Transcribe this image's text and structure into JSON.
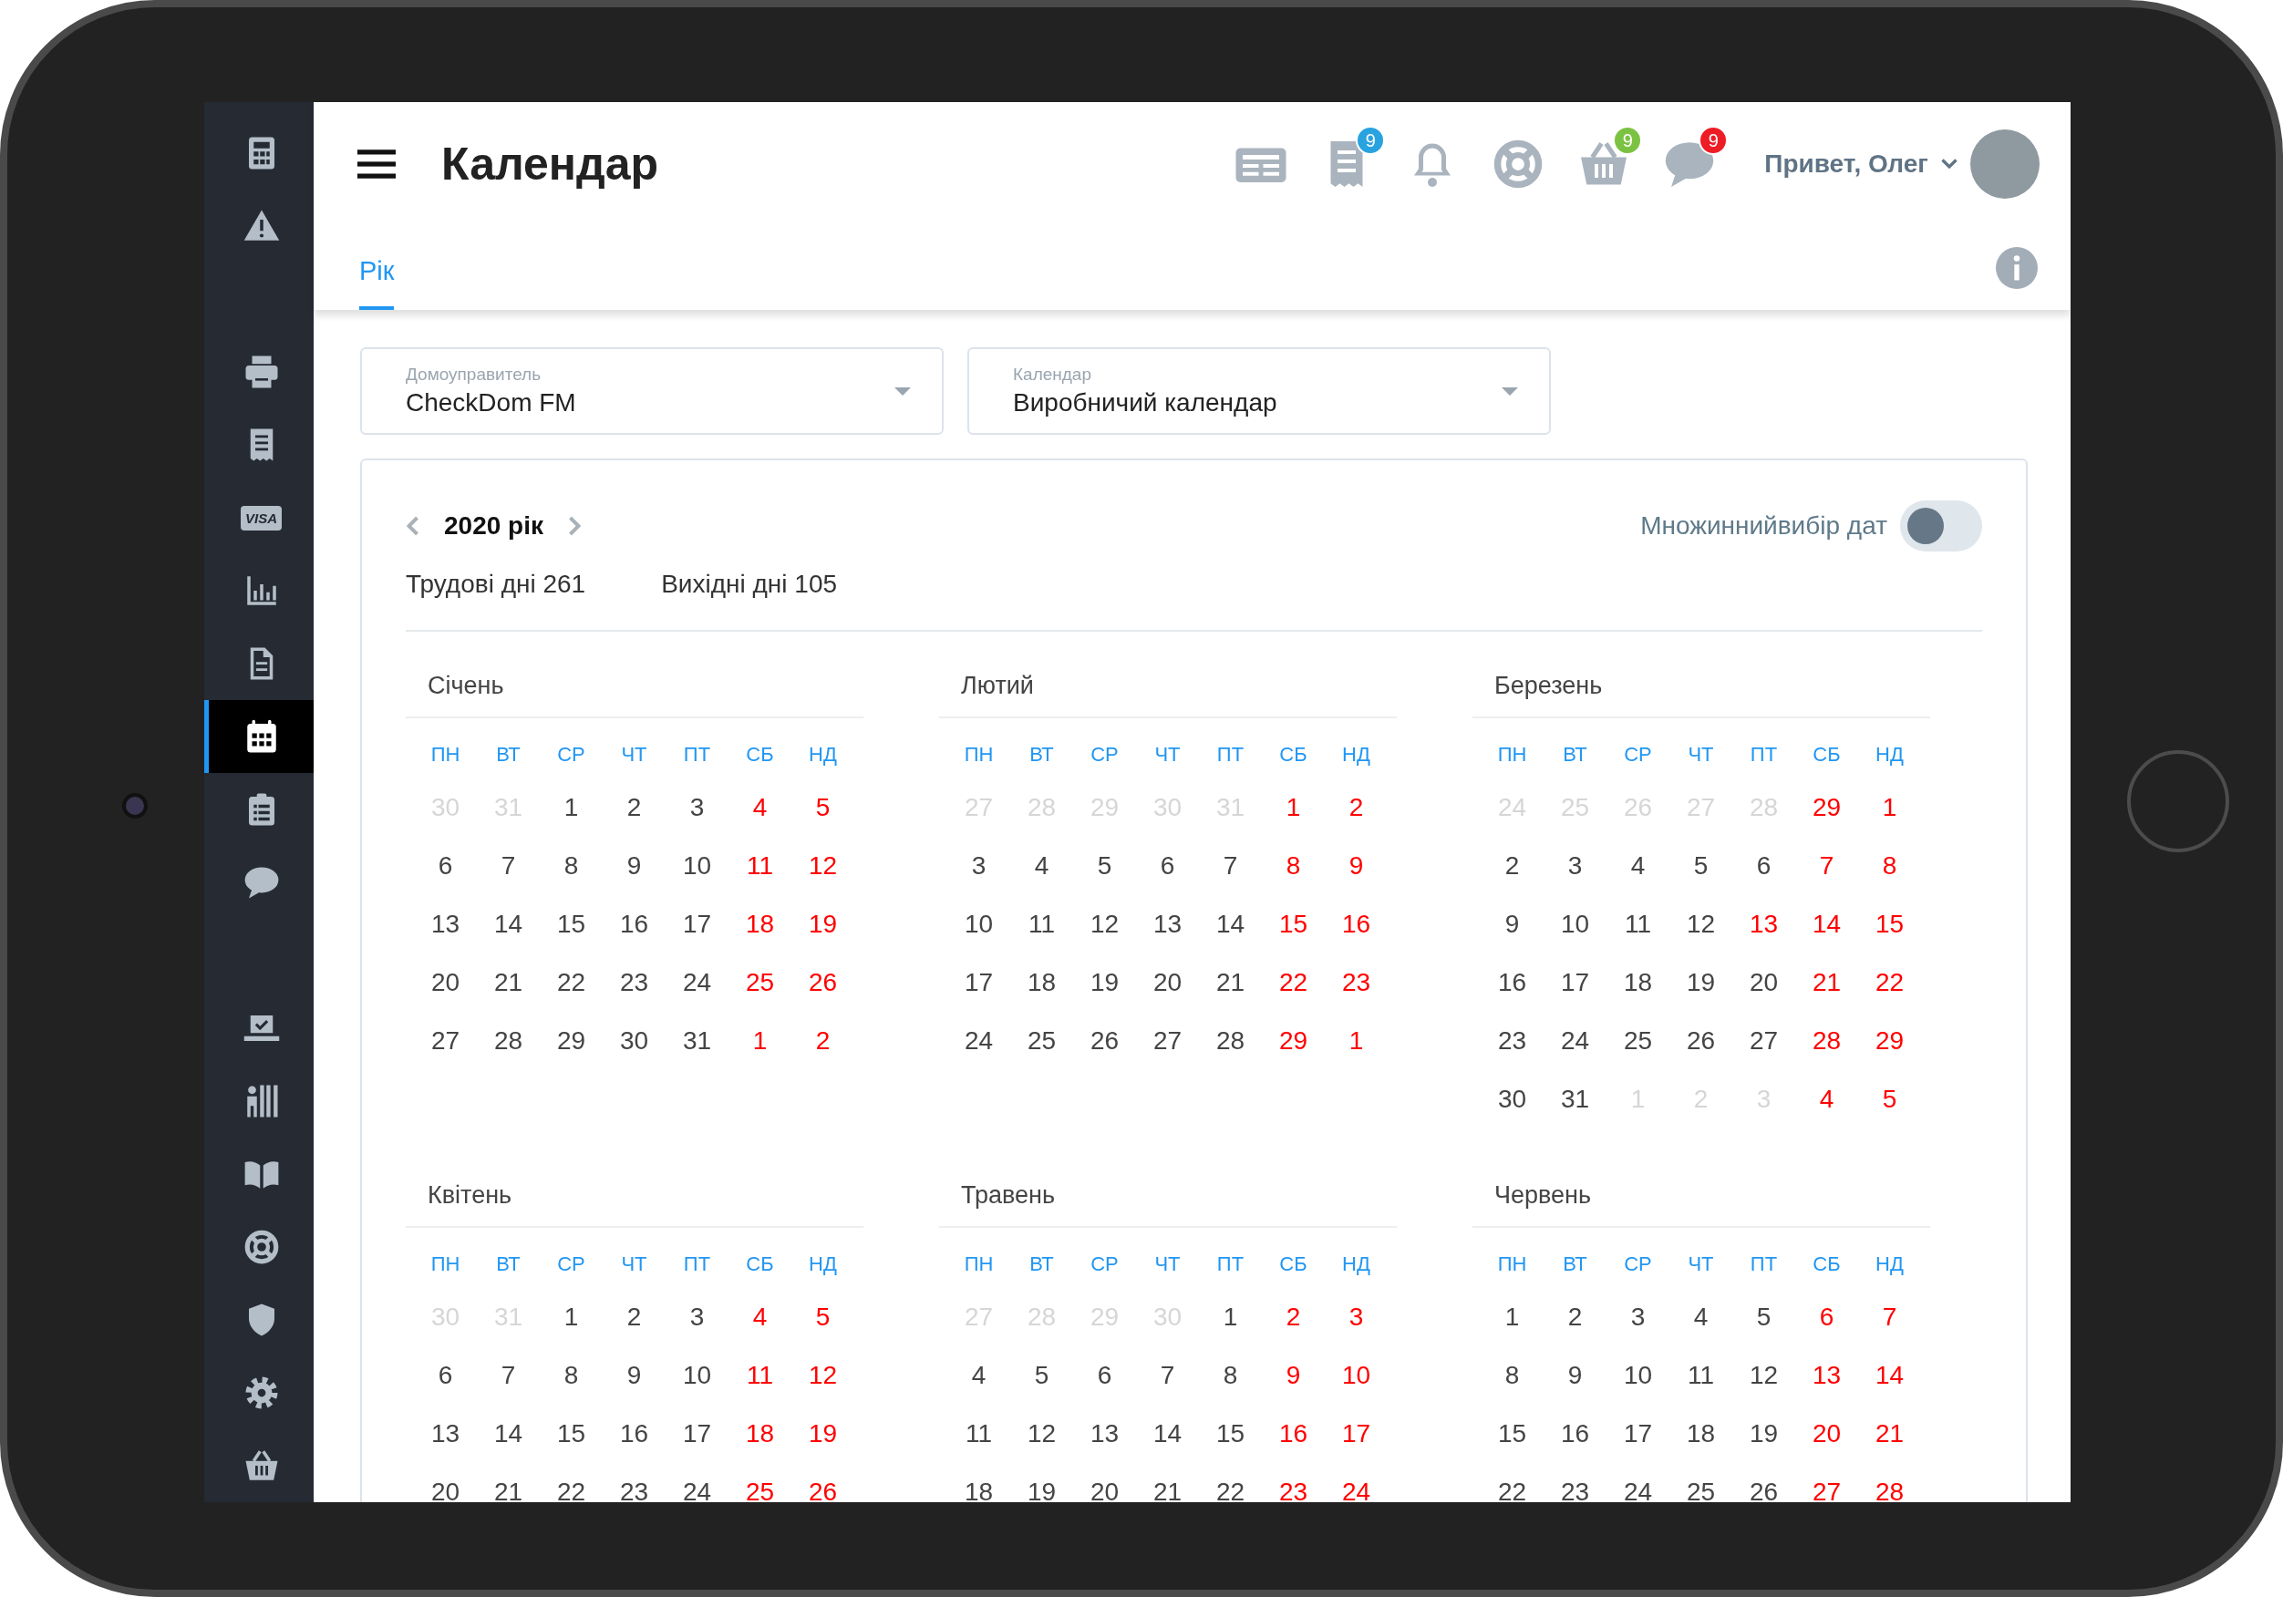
{
  "sidebar": {
    "groups": [
      [
        {
          "kind": "calculator",
          "selected": false
        },
        {
          "kind": "warning",
          "selected": false
        }
      ],
      [
        {
          "kind": "printer",
          "selected": false
        },
        {
          "kind": "receipt",
          "selected": false
        },
        {
          "kind": "card",
          "label": "VISA",
          "selected": false
        },
        {
          "kind": "bar-chart",
          "selected": false
        },
        {
          "kind": "document",
          "selected": false
        },
        {
          "kind": "calendar",
          "selected": true
        },
        {
          "kind": "clipboard",
          "selected": false
        },
        {
          "kind": "chat",
          "selected": false
        }
      ],
      [
        {
          "kind": "laptop-check",
          "selected": false
        },
        {
          "kind": "person-shelves",
          "selected": false
        },
        {
          "kind": "book",
          "selected": false
        },
        {
          "kind": "lifebuoy",
          "selected": false
        },
        {
          "kind": "shield",
          "selected": false
        },
        {
          "kind": "settings",
          "selected": false
        },
        {
          "kind": "basket",
          "selected": false
        }
      ]
    ]
  },
  "header": {
    "title": "Календар",
    "icons": [
      {
        "kind": "newspaper"
      },
      {
        "kind": "receipt",
        "badge": {
          "text": "9",
          "color": "#29a3e0"
        }
      },
      {
        "kind": "bell"
      },
      {
        "kind": "lifebuoy"
      },
      {
        "kind": "basket",
        "badge": {
          "text": "9",
          "color": "#7cc242"
        }
      },
      {
        "kind": "chat",
        "badge": {
          "text": "9",
          "color": "#ee1c25"
        }
      }
    ],
    "greeting": "Привет, Олег"
  },
  "tabs": [
    {
      "label": "Рік",
      "selected": true
    }
  ],
  "dropdowns": [
    {
      "label": "Домоуправитель",
      "value": "CheckDom FM"
    },
    {
      "label": "Календар",
      "value": "Виробничий календар"
    }
  ],
  "calendar": {
    "year": "2020 рік",
    "stats": [
      "Трудові дні 261",
      "Вихідні дні 105"
    ],
    "multi_select": {
      "label": "Множиннийвибір дат",
      "on": false
    },
    "months": [
      {
        "name": "Січень",
        "weekdays": [
          "ПН",
          "ВТ",
          "СР",
          "ЧТ",
          "ПТ",
          "СБ",
          "НД"
        ],
        "weeks": [
          [
            {
              "d": "30",
              "kind": "out"
            },
            {
              "d": "31",
              "kind": "out"
            },
            {
              "d": "1",
              "kind": "work"
            },
            {
              "d": "2",
              "kind": "work"
            },
            {
              "d": "3",
              "kind": "work"
            },
            {
              "d": "4",
              "kind": "off"
            },
            {
              "d": "5",
              "kind": "off"
            }
          ],
          [
            {
              "d": "6",
              "kind": "work"
            },
            {
              "d": "7",
              "kind": "work"
            },
            {
              "d": "8",
              "kind": "work"
            },
            {
              "d": "9",
              "kind": "work"
            },
            {
              "d": "10",
              "kind": "work"
            },
            {
              "d": "11",
              "kind": "off"
            },
            {
              "d": "12",
              "kind": "off"
            }
          ],
          [
            {
              "d": "13",
              "kind": "work"
            },
            {
              "d": "14",
              "kind": "work"
            },
            {
              "d": "15",
              "kind": "work"
            },
            {
              "d": "16",
              "kind": "work"
            },
            {
              "d": "17",
              "kind": "work"
            },
            {
              "d": "18",
              "kind": "off"
            },
            {
              "d": "19",
              "kind": "off"
            }
          ],
          [
            {
              "d": "20",
              "kind": "work"
            },
            {
              "d": "21",
              "kind": "work"
            },
            {
              "d": "22",
              "kind": "work"
            },
            {
              "d": "23",
              "kind": "work"
            },
            {
              "d": "24",
              "kind": "work"
            },
            {
              "d": "25",
              "kind": "off"
            },
            {
              "d": "26",
              "kind": "off"
            }
          ],
          [
            {
              "d": "27",
              "kind": "work"
            },
            {
              "d": "28",
              "kind": "work"
            },
            {
              "d": "29",
              "kind": "work"
            },
            {
              "d": "30",
              "kind": "work"
            },
            {
              "d": "31",
              "kind": "work"
            },
            {
              "d": "1",
              "kind": "off"
            },
            {
              "d": "2",
              "kind": "off"
            }
          ]
        ]
      },
      {
        "name": "Лютий",
        "weekdays": [
          "ПН",
          "ВТ",
          "СР",
          "ЧТ",
          "ПТ",
          "СБ",
          "НД"
        ],
        "weeks": [
          [
            {
              "d": "27",
              "kind": "out"
            },
            {
              "d": "28",
              "kind": "out"
            },
            {
              "d": "29",
              "kind": "out"
            },
            {
              "d": "30",
              "kind": "out"
            },
            {
              "d": "31",
              "kind": "out"
            },
            {
              "d": "1",
              "kind": "off"
            },
            {
              "d": "2",
              "kind": "off"
            }
          ],
          [
            {
              "d": "3",
              "kind": "work"
            },
            {
              "d": "4",
              "kind": "work"
            },
            {
              "d": "5",
              "kind": "work"
            },
            {
              "d": "6",
              "kind": "work"
            },
            {
              "d": "7",
              "kind": "work"
            },
            {
              "d": "8",
              "kind": "off"
            },
            {
              "d": "9",
              "kind": "off"
            }
          ],
          [
            {
              "d": "10",
              "kind": "work"
            },
            {
              "d": "11",
              "kind": "work"
            },
            {
              "d": "12",
              "kind": "work"
            },
            {
              "d": "13",
              "kind": "work"
            },
            {
              "d": "14",
              "kind": "work"
            },
            {
              "d": "15",
              "kind": "off"
            },
            {
              "d": "16",
              "kind": "off"
            }
          ],
          [
            {
              "d": "17",
              "kind": "work"
            },
            {
              "d": "18",
              "kind": "work"
            },
            {
              "d": "19",
              "kind": "work"
            },
            {
              "d": "20",
              "kind": "work"
            },
            {
              "d": "21",
              "kind": "work"
            },
            {
              "d": "22",
              "kind": "off"
            },
            {
              "d": "23",
              "kind": "off"
            }
          ],
          [
            {
              "d": "24",
              "kind": "work"
            },
            {
              "d": "25",
              "kind": "work"
            },
            {
              "d": "26",
              "kind": "work"
            },
            {
              "d": "27",
              "kind": "work"
            },
            {
              "d": "28",
              "kind": "work"
            },
            {
              "d": "29",
              "kind": "off"
            },
            {
              "d": "1",
              "kind": "off"
            }
          ]
        ]
      },
      {
        "name": "Березень",
        "weekdays": [
          "ПН",
          "ВТ",
          "СР",
          "ЧТ",
          "ПТ",
          "СБ",
          "НД"
        ],
        "weeks": [
          [
            {
              "d": "24",
              "kind": "out"
            },
            {
              "d": "25",
              "kind": "out"
            },
            {
              "d": "26",
              "kind": "out"
            },
            {
              "d": "27",
              "kind": "out"
            },
            {
              "d": "28",
              "kind": "out"
            },
            {
              "d": "29",
              "kind": "off"
            },
            {
              "d": "1",
              "kind": "off"
            }
          ],
          [
            {
              "d": "2",
              "kind": "work"
            },
            {
              "d": "3",
              "kind": "work"
            },
            {
              "d": "4",
              "kind": "work"
            },
            {
              "d": "5",
              "kind": "work"
            },
            {
              "d": "6",
              "kind": "work"
            },
            {
              "d": "7",
              "kind": "off"
            },
            {
              "d": "8",
              "kind": "off"
            }
          ],
          [
            {
              "d": "9",
              "kind": "work"
            },
            {
              "d": "10",
              "kind": "work"
            },
            {
              "d": "11",
              "kind": "work"
            },
            {
              "d": "12",
              "kind": "work"
            },
            {
              "d": "13",
              "kind": "off"
            },
            {
              "d": "14",
              "kind": "off"
            },
            {
              "d": "15",
              "kind": "off"
            }
          ],
          [
            {
              "d": "16",
              "kind": "work"
            },
            {
              "d": "17",
              "kind": "work"
            },
            {
              "d": "18",
              "kind": "work"
            },
            {
              "d": "19",
              "kind": "work"
            },
            {
              "d": "20",
              "kind": "work"
            },
            {
              "d": "21",
              "kind": "off"
            },
            {
              "d": "22",
              "kind": "off"
            }
          ],
          [
            {
              "d": "23",
              "kind": "work"
            },
            {
              "d": "24",
              "kind": "work"
            },
            {
              "d": "25",
              "kind": "work"
            },
            {
              "d": "26",
              "kind": "work"
            },
            {
              "d": "27",
              "kind": "work"
            },
            {
              "d": "28",
              "kind": "off"
            },
            {
              "d": "29",
              "kind": "off"
            }
          ],
          [
            {
              "d": "30",
              "kind": "work"
            },
            {
              "d": "31",
              "kind": "work"
            },
            {
              "d": "1",
              "kind": "out"
            },
            {
              "d": "2",
              "kind": "out"
            },
            {
              "d": "3",
              "kind": "out"
            },
            {
              "d": "4",
              "kind": "off"
            },
            {
              "d": "5",
              "kind": "off"
            }
          ]
        ]
      },
      {
        "name": "Квітень",
        "weekdays": [
          "ПН",
          "ВТ",
          "СР",
          "ЧТ",
          "ПТ",
          "СБ",
          "НД"
        ],
        "weeks": [
          [
            {
              "d": "30",
              "kind": "out"
            },
            {
              "d": "31",
              "kind": "out"
            },
            {
              "d": "1",
              "kind": "work"
            },
            {
              "d": "2",
              "kind": "work"
            },
            {
              "d": "3",
              "kind": "work"
            },
            {
              "d": "4",
              "kind": "off"
            },
            {
              "d": "5",
              "kind": "off"
            }
          ],
          [
            {
              "d": "6",
              "kind": "work"
            },
            {
              "d": "7",
              "kind": "work"
            },
            {
              "d": "8",
              "kind": "work"
            },
            {
              "d": "9",
              "kind": "work"
            },
            {
              "d": "10",
              "kind": "work"
            },
            {
              "d": "11",
              "kind": "off"
            },
            {
              "d": "12",
              "kind": "off"
            }
          ],
          [
            {
              "d": "13",
              "kind": "work"
            },
            {
              "d": "14",
              "kind": "work"
            },
            {
              "d": "15",
              "kind": "work"
            },
            {
              "d": "16",
              "kind": "work"
            },
            {
              "d": "17",
              "kind": "work"
            },
            {
              "d": "18",
              "kind": "off"
            },
            {
              "d": "19",
              "kind": "off"
            }
          ],
          [
            {
              "d": "20",
              "kind": "work"
            },
            {
              "d": "21",
              "kind": "work"
            },
            {
              "d": "22",
              "kind": "work"
            },
            {
              "d": "23",
              "kind": "work"
            },
            {
              "d": "24",
              "kind": "work"
            },
            {
              "d": "25",
              "kind": "off"
            },
            {
              "d": "26",
              "kind": "off"
            }
          ]
        ]
      },
      {
        "name": "Травень",
        "weekdays": [
          "ПН",
          "ВТ",
          "СР",
          "ЧТ",
          "ПТ",
          "СБ",
          "НД"
        ],
        "weeks": [
          [
            {
              "d": "27",
              "kind": "out"
            },
            {
              "d": "28",
              "kind": "out"
            },
            {
              "d": "29",
              "kind": "out"
            },
            {
              "d": "30",
              "kind": "out"
            },
            {
              "d": "1",
              "kind": "work"
            },
            {
              "d": "2",
              "kind": "off"
            },
            {
              "d": "3",
              "kind": "off"
            }
          ],
          [
            {
              "d": "4",
              "kind": "work"
            },
            {
              "d": "5",
              "kind": "work"
            },
            {
              "d": "6",
              "kind": "work"
            },
            {
              "d": "7",
              "kind": "work"
            },
            {
              "d": "8",
              "kind": "work"
            },
            {
              "d": "9",
              "kind": "off"
            },
            {
              "d": "10",
              "kind": "off"
            }
          ],
          [
            {
              "d": "11",
              "kind": "work"
            },
            {
              "d": "12",
              "kind": "work"
            },
            {
              "d": "13",
              "kind": "work"
            },
            {
              "d": "14",
              "kind": "work"
            },
            {
              "d": "15",
              "kind": "work"
            },
            {
              "d": "16",
              "kind": "off"
            },
            {
              "d": "17",
              "kind": "off"
            }
          ],
          [
            {
              "d": "18",
              "kind": "work"
            },
            {
              "d": "19",
              "kind": "work"
            },
            {
              "d": "20",
              "kind": "work"
            },
            {
              "d": "21",
              "kind": "work"
            },
            {
              "d": "22",
              "kind": "work"
            },
            {
              "d": "23",
              "kind": "off"
            },
            {
              "d": "24",
              "kind": "off"
            }
          ]
        ]
      },
      {
        "name": "Червень",
        "weekdays": [
          "ПН",
          "ВТ",
          "СР",
          "ЧТ",
          "ПТ",
          "СБ",
          "НД"
        ],
        "weeks": [
          [
            {
              "d": "1",
              "kind": "work"
            },
            {
              "d": "2",
              "kind": "work"
            },
            {
              "d": "3",
              "kind": "work"
            },
            {
              "d": "4",
              "kind": "work"
            },
            {
              "d": "5",
              "kind": "work"
            },
            {
              "d": "6",
              "kind": "off"
            },
            {
              "d": "7",
              "kind": "off"
            }
          ],
          [
            {
              "d": "8",
              "kind": "work"
            },
            {
              "d": "9",
              "kind": "work"
            },
            {
              "d": "10",
              "kind": "work"
            },
            {
              "d": "11",
              "kind": "work"
            },
            {
              "d": "12",
              "kind": "work"
            },
            {
              "d": "13",
              "kind": "off"
            },
            {
              "d": "14",
              "kind": "off"
            }
          ],
          [
            {
              "d": "15",
              "kind": "work"
            },
            {
              "d": "16",
              "kind": "work"
            },
            {
              "d": "17",
              "kind": "work"
            },
            {
              "d": "18",
              "kind": "work"
            },
            {
              "d": "19",
              "kind": "work"
            },
            {
              "d": "20",
              "kind": "off"
            },
            {
              "d": "21",
              "kind": "off"
            }
          ],
          [
            {
              "d": "22",
              "kind": "work"
            },
            {
              "d": "23",
              "kind": "work"
            },
            {
              "d": "24",
              "kind": "work"
            },
            {
              "d": "25",
              "kind": "work"
            },
            {
              "d": "26",
              "kind": "work"
            },
            {
              "d": "27",
              "kind": "off"
            },
            {
              "d": "28",
              "kind": "off"
            }
          ]
        ]
      }
    ]
  }
}
